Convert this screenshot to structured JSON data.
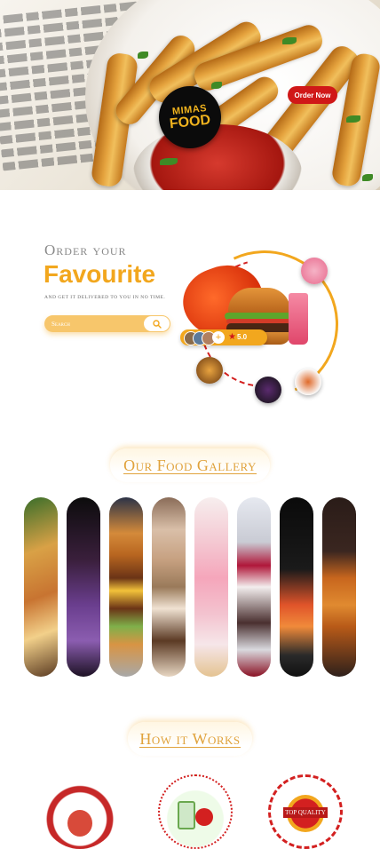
{
  "hero": {
    "logo_line1": "MIMAS",
    "logo_line2": "FOOD",
    "order_button": "Order Now"
  },
  "order": {
    "heading_small": "Order your",
    "heading_big": "Favourite",
    "tagline": "and get it delivered to you in no time.",
    "search_placeholder": "Search",
    "rating": "5.0"
  },
  "gallery": {
    "title": "Our Food Gallery",
    "items": [
      "pizza",
      "blueberry-dessert",
      "burger",
      "donuts",
      "popsicles",
      "cupcakes",
      "grapefruit-drink",
      "waffles"
    ]
  },
  "how": {
    "title": "How it Works",
    "badge_text": "TOP QUALITY"
  },
  "colors": {
    "accent": "#f2a71e",
    "brand_red": "#d01818"
  }
}
